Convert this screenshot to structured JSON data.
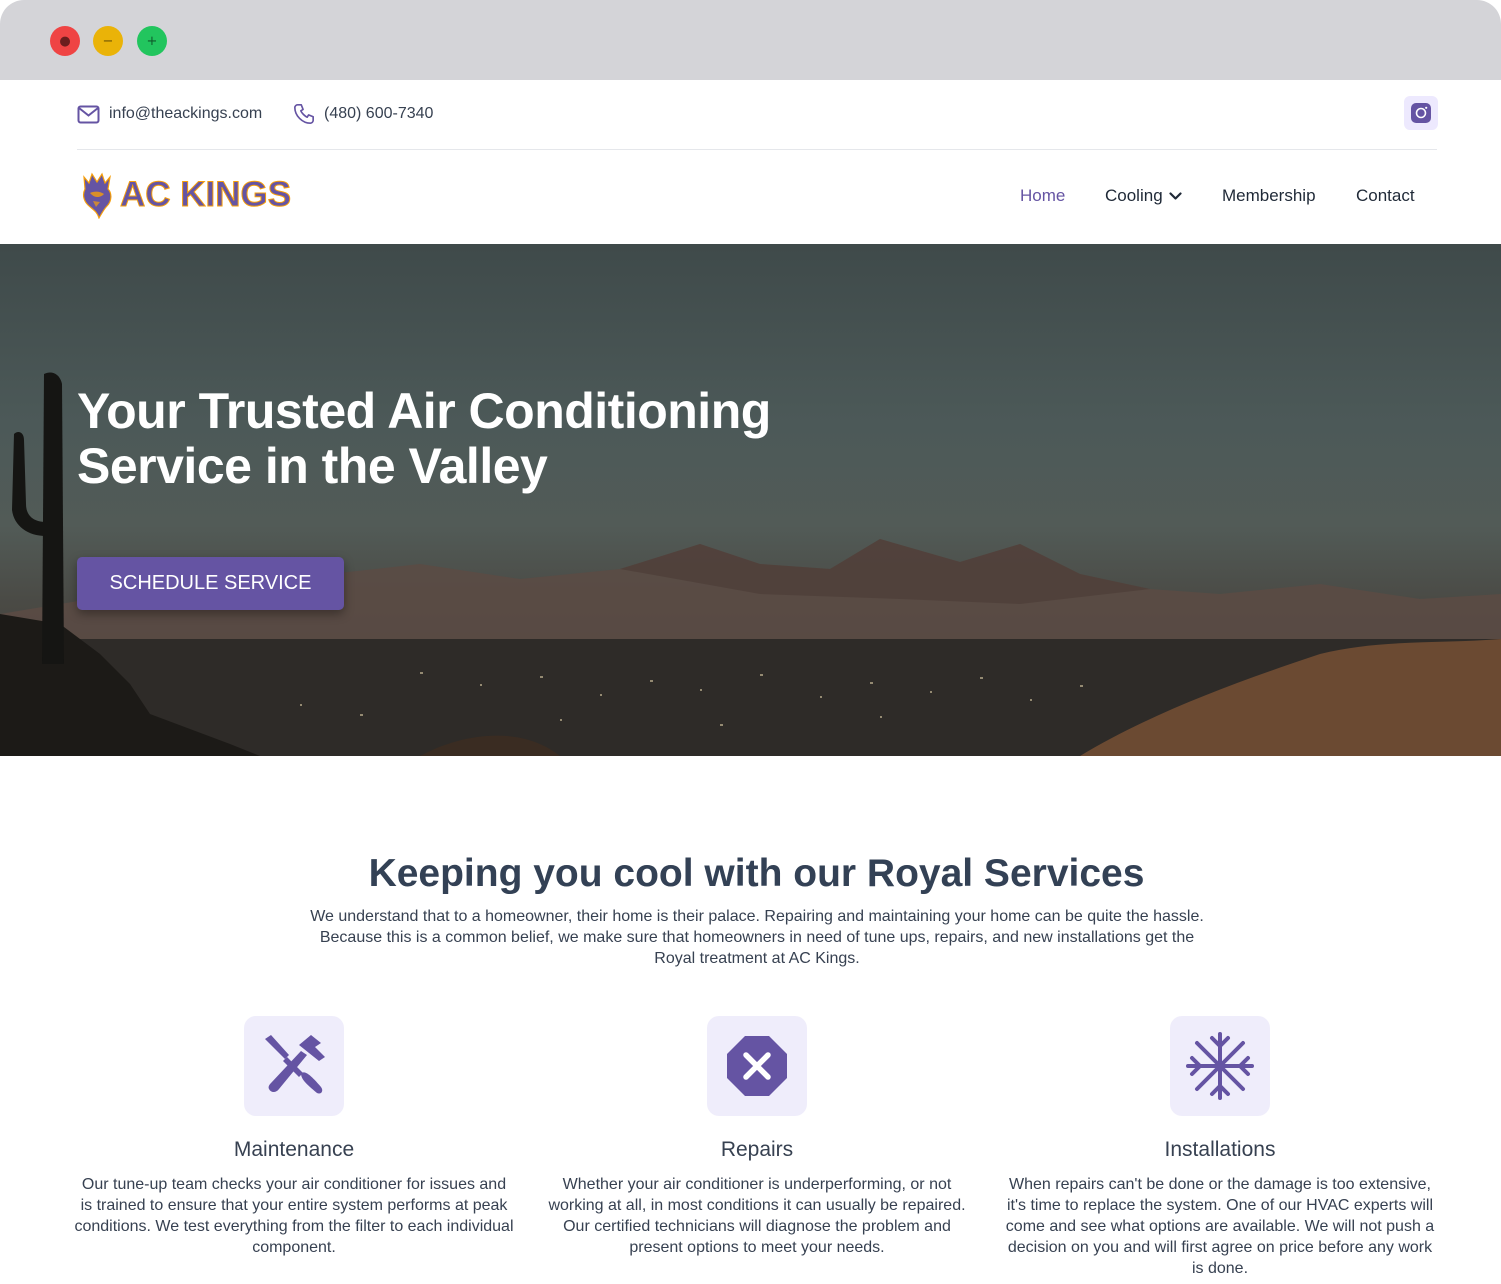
{
  "window": {
    "buttons": [
      "close",
      "minimize",
      "maximize"
    ]
  },
  "topbar": {
    "email": "info@theackings.com",
    "phone": "(480) 600-7340",
    "email_icon": "mail-icon",
    "phone_icon": "phone-icon",
    "social_icon": "instagram-icon"
  },
  "brand": {
    "name": "AC KINGS",
    "logo_icon": "lion-crown-icon",
    "color": "#6554a3"
  },
  "nav": {
    "items": [
      {
        "label": "Home",
        "active": true
      },
      {
        "label": "Cooling",
        "has_dropdown": true
      },
      {
        "label": "Membership"
      },
      {
        "label": "Contact"
      }
    ]
  },
  "hero": {
    "title": "Your Trusted Air Conditioning Service in the Valley",
    "cta_label": "SCHEDULE SERVICE"
  },
  "services": {
    "title": "Keeping you cool with our Royal Services",
    "intro": "We understand that to a homeowner, their home is their palace. Repairing and maintaining your home can be quite the hassle. Because this is a common belief, we make sure that homeowners in need of tune ups, repairs, and new installations get the Royal treatment at AC Kings.",
    "items": [
      {
        "icon": "tools-icon",
        "title": "Maintenance",
        "text": "Our tune-up team checks your air conditioner for issues and is trained to ensure that your entire system performs at peak conditions. We test everything from the filter to each individual component."
      },
      {
        "icon": "octagon-x-icon",
        "title": "Repairs",
        "text": "Whether your air conditioner is underperforming, or not working at all, in most conditions it can usually be repaired. Our certified technicians will diagnose the problem and present options to meet your needs."
      },
      {
        "icon": "snowflake-icon",
        "title": "Installations",
        "text": "When repairs can't be done or the damage is too extensive, it's time to replace the system. One of our HVAC experts will come and see what options are available. We will not push a decision on you and will first agree on price before any work is done."
      }
    ]
  }
}
